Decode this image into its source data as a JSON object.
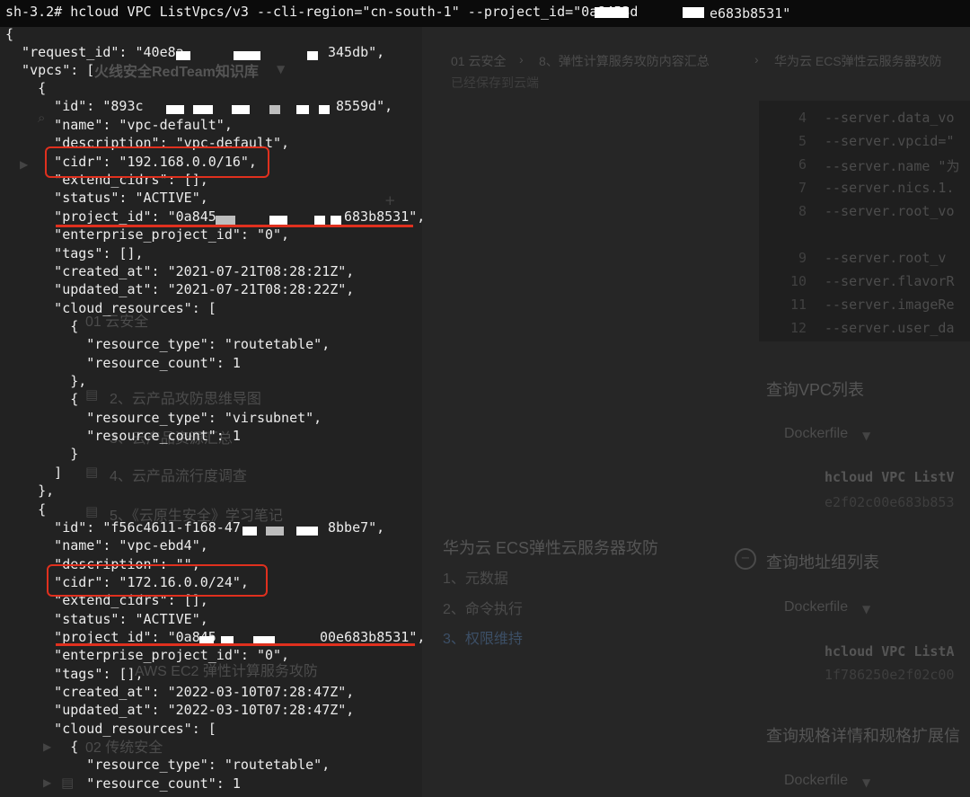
{
  "terminal": {
    "command": "sh-3.2# hcloud VPC ListVpcs/v3 --cli-region=\"cn-south-1\" --project_id=\"0a8453d",
    "command_tail": "e683b8531\"",
    "lines": [
      "{",
      "  \"request_id\": \"40e8a",
      "  \"vpcs\": [",
      "    {",
      "      \"id\": \"893c",
      "      \"name\": \"vpc-default\",",
      "      \"description\": \"vpc-default\",",
      "      \"cidr\": \"192.168.0.0/16\",",
      "      \"extend_cidrs\": [],",
      "      \"status\": \"ACTIVE\",",
      "      \"project_id\": \"0a845",
      "      \"enterprise_project_id\": \"0\",",
      "      \"tags\": [],",
      "      \"created_at\": \"2021-07-21T08:28:21Z\",",
      "      \"updated_at\": \"2021-07-21T08:28:22Z\",",
      "      \"cloud_resources\": [",
      "        {",
      "          \"resource_type\": \"routetable\",",
      "          \"resource_count\": 1",
      "        },",
      "        {",
      "          \"resource_type\": \"virsubnet\",",
      "          \"resource_count\": 1",
      "        }",
      "      ]",
      "    },",
      "    {",
      "      \"id\": \"f56c4611-f168-47",
      "      \"name\": \"vpc-ebd4\",",
      "      \"description\": \"\",",
      "      \"cidr\": \"172.16.0.0/24\",",
      "      \"extend_cidrs\": [],",
      "      \"status\": \"ACTIVE\",",
      "      \"project_id\": \"0a845",
      "      \"enterprise_project_id\": \"0\",",
      "      \"tags\": [],",
      "      \"created_at\": \"2022-03-10T07:28:47Z\",",
      "      \"updated_at\": \"2022-03-10T07:28:47Z\",",
      "      \"cloud_resources\": [",
      "        {",
      "          \"resource_type\": \"routetable\",",
      "          \"resource_count\": 1"
    ],
    "tails": {
      "request_id": "345db\",",
      "vpc1_id": "8559d\",",
      "vpc1_project_id": "683b8531\",",
      "vpc2_id": "8bbe7\",",
      "vpc2_project_id": "00e683b8531\","
    }
  },
  "background": {
    "sidebar_title": "火线安全RedTeam知识库",
    "sidebar_items": [
      "01 云安全",
      "2、云产品攻防思维导图",
      "3、云产品资源汇总",
      "4、云产品流行度调查",
      "5、《云原生安全》学习笔记",
      "AWS EC2 弹性计算服务攻防",
      "02 传统安全"
    ],
    "breadcrumb": [
      "01 云安全",
      "8、弹性计算服务攻防内容汇总",
      "华为云 ECS弹性云服务器攻防"
    ],
    "save_status": "已经保存到云端",
    "code_lines": [
      {
        "num": "4",
        "text": "--server.data_vo"
      },
      {
        "num": "5",
        "text": "--server.vpcid=\""
      },
      {
        "num": "6",
        "text": "--server.name \"为"
      },
      {
        "num": "7",
        "text": "--server.nics.1."
      },
      {
        "num": "8",
        "text": "--server.root_vo"
      },
      {
        "num": "9",
        "text": "--server.root_v"
      },
      {
        "num": "10",
        "text": "--server.flavorR"
      },
      {
        "num": "11",
        "text": "--server.imageRe"
      },
      {
        "num": "12",
        "text": "--server.user_da"
      }
    ],
    "h_vpc_list": "查询VPC列表",
    "h_addr_group": "查询地址组列表",
    "h_flavor": "查询规格详情和规格扩展信",
    "dockerfile_label": "Dockerfile",
    "snippet1": "hcloud VPC ListV",
    "snippet1_sub": "e2f02c00e683b853",
    "snippet2": "hcloud VPC ListA",
    "snippet2_sub": "1f786250e2f02c00",
    "outline_title": "华为云 ECS弹性云服务器攻防",
    "outline_items": [
      "1、元数据",
      "2、命令执行",
      "3、权限维持"
    ]
  }
}
